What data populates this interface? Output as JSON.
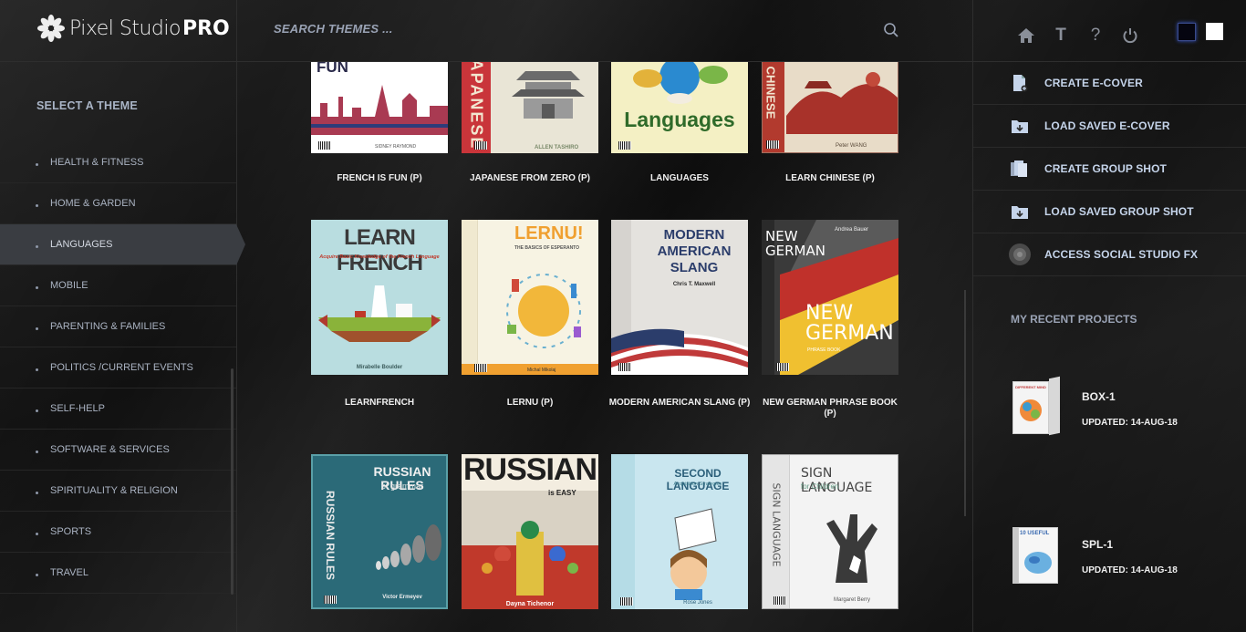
{
  "app": {
    "logo_text": "Pixel Studio",
    "logo_pro": "PRO"
  },
  "search": {
    "placeholder": "SEARCH THEMES ..."
  },
  "top_icons": [
    "home-icon",
    "text-icon",
    "help-icon",
    "power-icon"
  ],
  "top_icon_glyphs": {
    "text": "T",
    "help": "?"
  },
  "theme_swatches": {
    "dark": "#050510",
    "light": "#ffffff"
  },
  "sidebar": {
    "title": "SELECT A THEME",
    "items": [
      {
        "label": "HEALTH & FITNESS"
      },
      {
        "label": "HOME & GARDEN"
      },
      {
        "label": "LANGUAGES",
        "active": true
      },
      {
        "label": "MOBILE"
      },
      {
        "label": "PARENTING & FAMILIES"
      },
      {
        "label": "POLITICS /CURRENT EVENTS"
      },
      {
        "label": "SELF-HELP"
      },
      {
        "label": "SOFTWARE & SERVICES"
      },
      {
        "label": "SPIRITUALITY & RELIGION"
      },
      {
        "label": "SPORTS"
      },
      {
        "label": "TRAVEL"
      }
    ]
  },
  "themes": [
    {
      "label": "FRENCH IS FUN (P)",
      "cover_title": "FUN",
      "cover_author": "SIDNEY RAYMOND"
    },
    {
      "label": "JAPANESE FROM ZERO (P)",
      "cover_title": "JAPANESE",
      "cover_author": "ALLEN TASHIRO"
    },
    {
      "label": "LANGUAGES",
      "cover_title": "Languages",
      "cover_author": ""
    },
    {
      "label": "LEARN CHINESE (P)",
      "cover_title": "CHINESE",
      "cover_author": "Peter WANG"
    },
    {
      "label": "LEARNFRENCH",
      "cover_title": "LEARN FRENCH",
      "cover_sub": "Acquire Basic Knowledge of the French Language",
      "cover_author": "Mirabelle Boulder"
    },
    {
      "label": "LERNU (P)",
      "cover_title": "LERNU!",
      "cover_sub": "THE BASICS OF ESPERANTO",
      "cover_author": "Michal Mikolaj"
    },
    {
      "label": "MODERN AMERICAN SLANG (P)",
      "cover_title": "MODERN AMERICAN SLANG",
      "cover_author": "Chris T. Maxwell"
    },
    {
      "label": "NEW GERMAN PHRASE BOOK (P)",
      "cover_title": "NEW GERMAN",
      "cover_sub": "PHRASE BOOK",
      "cover_author": "Andrea Bauer"
    },
    {
      "label": "",
      "cover_title": "RUSSIAN RULES",
      "cover_sub": "of grammar",
      "cover_author": "Victor Ermeyev"
    },
    {
      "label": "",
      "cover_title": "RUSSIAN",
      "cover_sub": "is EASY",
      "cover_author": "Dayna Tichenor"
    },
    {
      "label": "",
      "cover_title": "SECOND LANGUAGE",
      "cover_sub": "Acquisition Strategies",
      "cover_author": "Rose Jones"
    },
    {
      "label": "",
      "cover_title": "SIGN LANGUAGE",
      "cover_sub": "for Children",
      "cover_author": "Margaret Berry"
    }
  ],
  "actions": [
    {
      "label": "CREATE E-COVER",
      "icon": "new-file-icon"
    },
    {
      "label": "LOAD SAVED E-COVER",
      "icon": "load-folder-icon"
    },
    {
      "label": "CREATE GROUP SHOT",
      "icon": "stacked-files-icon"
    },
    {
      "label": "LOAD SAVED GROUP SHOT",
      "icon": "load-folder-icon"
    },
    {
      "label": "ACCESS SOCIAL STUDIO FX",
      "icon": "social-icon"
    }
  ],
  "recent": {
    "title": "MY RECENT PROJECTS",
    "projects": [
      {
        "name": "BOX-1",
        "updated": "UPDATED: 14-AUG-18",
        "thumb_text": "DIFFERENT MIND"
      },
      {
        "name": "SPL-1",
        "updated": "UPDATED: 14-AUG-18",
        "thumb_text": "10 USEFUL"
      }
    ]
  }
}
